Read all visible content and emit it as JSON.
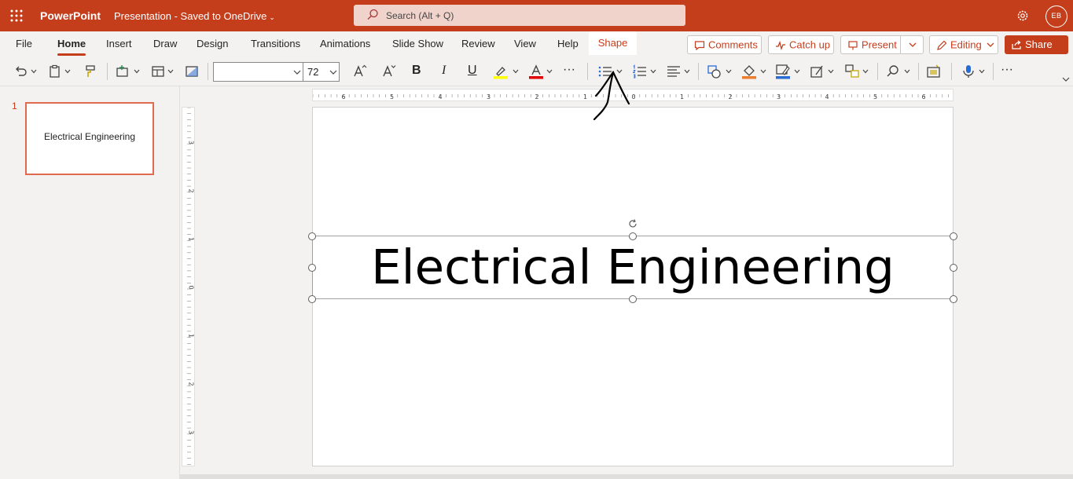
{
  "app": {
    "name": "PowerPoint",
    "document_title": "Presentation - Saved to OneDrive",
    "title_chevron": "⌄"
  },
  "search": {
    "placeholder": "Search (Alt + Q)"
  },
  "user": {
    "initials": "EB"
  },
  "tabs": [
    {
      "label": "File"
    },
    {
      "label": "Home"
    },
    {
      "label": "Insert"
    },
    {
      "label": "Draw"
    },
    {
      "label": "Design"
    },
    {
      "label": "Transitions"
    },
    {
      "label": "Animations"
    },
    {
      "label": "Slide Show"
    },
    {
      "label": "Review"
    },
    {
      "label": "View"
    },
    {
      "label": "Help"
    },
    {
      "label": "Shape"
    }
  ],
  "active_tab": "Home",
  "header_buttons": {
    "comments": "Comments",
    "catch_up": "Catch up",
    "present": "Present",
    "editing": "Editing",
    "share": "Share"
  },
  "ribbon": {
    "font_name": "",
    "font_size": "72",
    "bold": "B",
    "italic": "I",
    "underline": "U",
    "more": "···"
  },
  "thumbnails": [
    {
      "number": "1",
      "title": "Electrical Engineering"
    }
  ],
  "slide": {
    "title": "Electrical Engineering"
  },
  "rulers": {
    "horizontal_labels": [
      "6",
      "5",
      "4",
      "3",
      "2",
      "1",
      "0",
      "1",
      "2",
      "3",
      "4",
      "5",
      "6"
    ],
    "vertical_labels": [
      "3",
      "2",
      "1",
      "0",
      "1",
      "2",
      "3"
    ]
  },
  "colors": {
    "accent": "#c43e1c",
    "highlight": "#ffff00",
    "font_color": "#e00000",
    "fill": "#ed7d31",
    "outline": "#2b6cd4"
  }
}
